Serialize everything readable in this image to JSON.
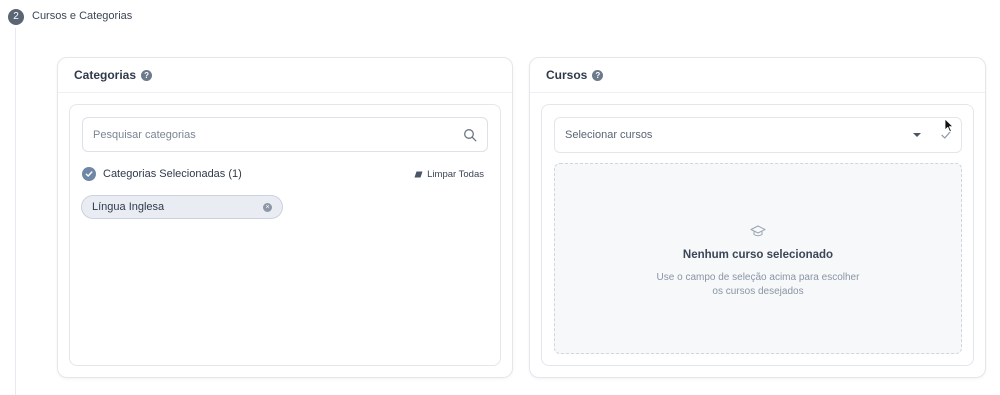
{
  "step": {
    "number": "2",
    "title": "Cursos e Categorias"
  },
  "categories": {
    "title": "Categorias",
    "help_icon": "question-circle-icon",
    "search": {
      "placeholder": "Pesquisar categorias",
      "value": "",
      "icon": "search-icon"
    },
    "selected_label": "Categorias Selecionadas (1)",
    "clear_all_label": "Limpar Todas",
    "chips": [
      {
        "label": "Língua Inglesa"
      }
    ]
  },
  "courses": {
    "title": "Cursos",
    "help_icon": "question-circle-icon",
    "select": {
      "placeholder": "Selecionar cursos"
    },
    "empty": {
      "icon": "graduation-cap-icon",
      "title": "Nenhum curso selecionado",
      "line1": "Use o campo de seleção acima para escolher",
      "line2": "os cursos desejados"
    }
  },
  "colors": {
    "accent": "#6f87a7",
    "border": "#e3e7ec",
    "chip_bg": "#e9edf3"
  }
}
